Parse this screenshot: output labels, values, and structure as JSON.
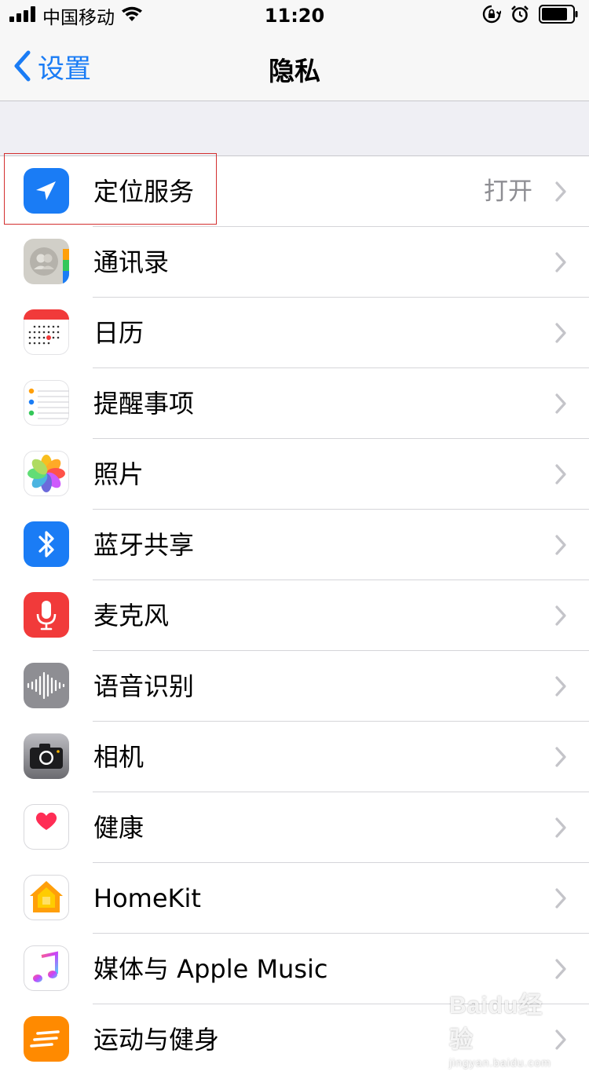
{
  "status_bar": {
    "carrier": "中国移动",
    "time": "11:20",
    "icons": [
      "signal-icon",
      "wifi-icon",
      "rotation-lock-icon",
      "alarm-icon",
      "battery-icon"
    ]
  },
  "nav": {
    "back_label": "设置",
    "title": "隐私"
  },
  "items": [
    {
      "label": "定位服务",
      "value": "打开",
      "icon": "location-icon",
      "color": "#1a7cf5"
    },
    {
      "label": "通讯录",
      "value": "",
      "icon": "contacts-icon",
      "color": "#d1cfc8"
    },
    {
      "label": "日历",
      "value": "",
      "icon": "calendar-icon",
      "color": "#ffffff"
    },
    {
      "label": "提醒事项",
      "value": "",
      "icon": "reminders-icon",
      "color": "#ffffff"
    },
    {
      "label": "照片",
      "value": "",
      "icon": "photos-icon",
      "color": "#ffffff"
    },
    {
      "label": "蓝牙共享",
      "value": "",
      "icon": "bluetooth-icon",
      "color": "#1a7cf5"
    },
    {
      "label": "麦克风",
      "value": "",
      "icon": "microphone-icon",
      "color": "#f13a3a"
    },
    {
      "label": "语音识别",
      "value": "",
      "icon": "speech-recognition-icon",
      "color": "#8e8e93"
    },
    {
      "label": "相机",
      "value": "",
      "icon": "camera-icon",
      "color": "#5f5f63"
    },
    {
      "label": "健康",
      "value": "",
      "icon": "health-icon",
      "color": "#ffffff"
    },
    {
      "label": "HomeKit",
      "value": "",
      "icon": "homekit-icon",
      "color": "#ffffff"
    },
    {
      "label": "媒体与 Apple Music",
      "value": "",
      "icon": "music-icon",
      "color": "#ffffff"
    },
    {
      "label": "运动与健身",
      "value": "",
      "icon": "motion-fitness-icon",
      "color": "#ff8a00"
    }
  ],
  "watermark": {
    "main": "Baidu经验",
    "sub": "jingyan.baidu.com"
  }
}
